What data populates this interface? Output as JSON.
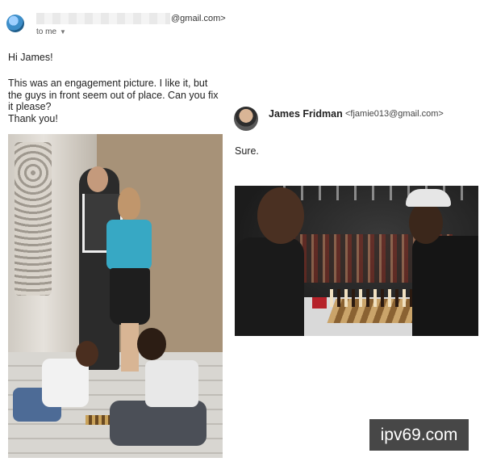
{
  "email_left": {
    "sender_domain": "@gmail.com>",
    "to_me": "to me",
    "greeting": "Hi James!",
    "message": "This was an engagement picture. I like it, but\nthe guys in front seem out of place. Can you fix\nit please?\nThank you!"
  },
  "reply": {
    "name": "James Fridman",
    "email": "<fjamie013@gmail.com>",
    "text": "Sure."
  },
  "watermark": "ipv69.com"
}
